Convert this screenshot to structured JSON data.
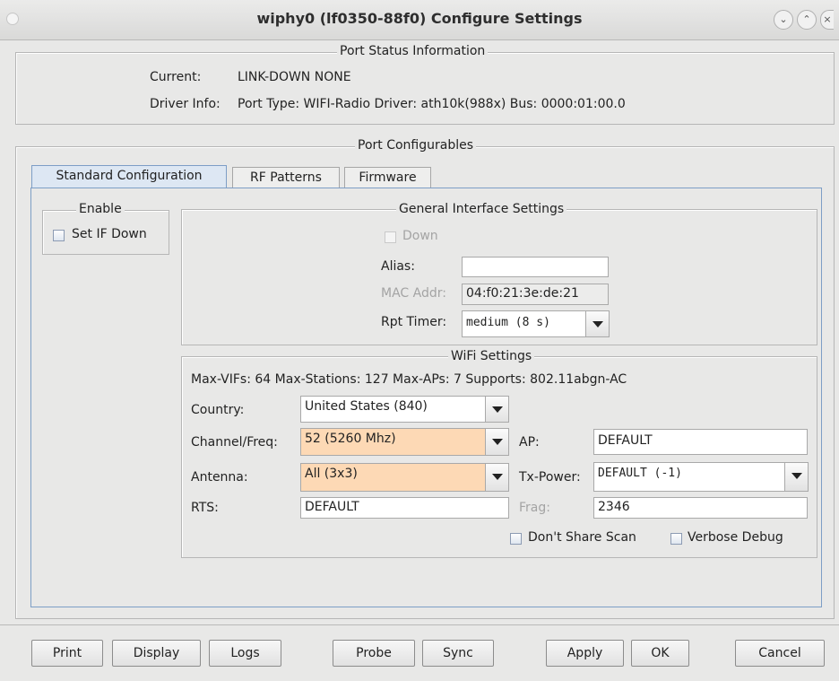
{
  "window": {
    "title": "wiphy0  (lf0350-88f0) Configure Settings"
  },
  "status": {
    "heading": "Port Status Information",
    "current_label": "Current:",
    "current_value": "LINK-DOWN  NONE",
    "driver_label": "Driver Info:",
    "driver_value": "Port Type: WIFI-Radio   Driver: ath10k(988x)  Bus: 0000:01:00.0"
  },
  "configurables": {
    "heading": "Port Configurables"
  },
  "tabs": [
    {
      "label": "Standard Configuration",
      "active": true
    },
    {
      "label": "RF Patterns",
      "active": false
    },
    {
      "label": "Firmware",
      "active": false
    }
  ],
  "enable": {
    "heading": "Enable",
    "set_if_down": "Set IF Down"
  },
  "general": {
    "heading": "General Interface Settings",
    "down_label": "Down",
    "alias_label": "Alias:",
    "alias_value": "",
    "mac_label": "MAC Addr:",
    "mac_value": "04:f0:21:3e:de:21",
    "rpt_label": "Rpt Timer:",
    "rpt_value": "medium   (8 s)"
  },
  "wifi": {
    "heading": "WiFi Settings",
    "caps": "Max-VIFs: 64  Max-Stations: 127  Max-APs: 7  Supports: 802.11abgn-AC",
    "country_label": "Country:",
    "country_value": "United States (840)",
    "channel_label": "Channel/Freq:",
    "channel_value": "52 (5260 Mhz)",
    "ap_label": "AP:",
    "ap_value": "DEFAULT",
    "antenna_label": "Antenna:",
    "antenna_value": "All (3x3)",
    "txpower_label": "Tx-Power:",
    "txpower_value": "DEFAULT  (-1)",
    "rts_label": "RTS:",
    "rts_value": "DEFAULT",
    "frag_label": "Frag:",
    "frag_value": "2346",
    "dont_share_scan": "Don't Share Scan",
    "verbose_debug": "Verbose Debug",
    "highlight_color": "#fdd9b5"
  },
  "buttons": {
    "print": "Print",
    "display": "Display",
    "logs": "Logs",
    "probe": "Probe",
    "sync": "Sync",
    "apply": "Apply",
    "ok": "OK",
    "cancel": "Cancel"
  }
}
